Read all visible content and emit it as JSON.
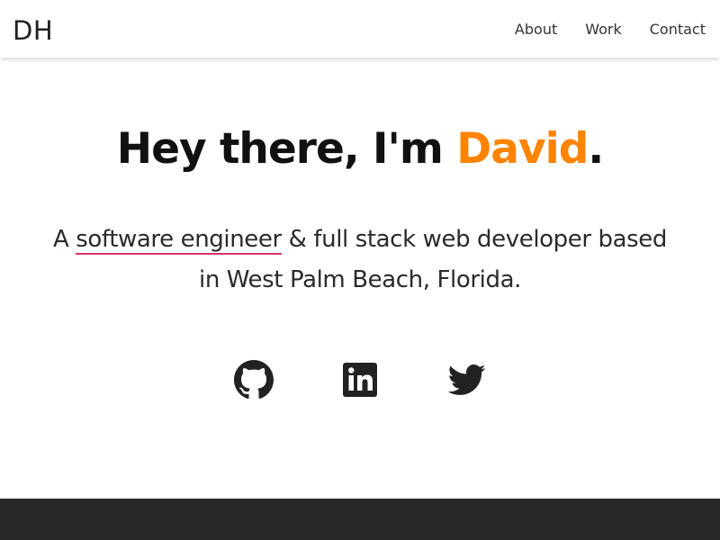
{
  "header": {
    "logo": "DH",
    "nav": [
      "About",
      "Work",
      "Contact"
    ]
  },
  "hero": {
    "title_prefix": "Hey there, I'm ",
    "title_name": "David",
    "title_suffix": ".",
    "subtitle_start": "A ",
    "subtitle_highlight": "software engineer",
    "subtitle_rest": " & full stack web developer based in West Palm Beach, Florida."
  },
  "socials": [
    {
      "name": "github-icon"
    },
    {
      "name": "linkedin-icon"
    },
    {
      "name": "twitter-icon"
    }
  ],
  "colors": {
    "accent": "#ff8400",
    "underline": "#d6336c",
    "footer": "#282828"
  }
}
